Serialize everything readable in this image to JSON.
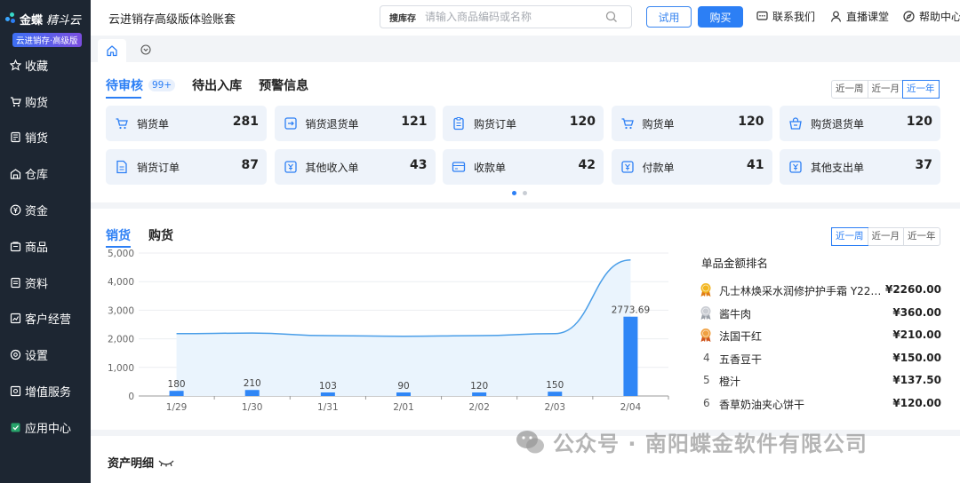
{
  "brand": {
    "name": "金蝶",
    "product": "精斗云",
    "edition_badge": "云进销存·高级版"
  },
  "sidebar": {
    "items": [
      {
        "label": "收藏",
        "icon": "star-icon"
      },
      {
        "label": "购货",
        "icon": "cart-icon"
      },
      {
        "label": "销货",
        "icon": "sales-doc-icon"
      },
      {
        "label": "仓库",
        "icon": "warehouse-icon"
      },
      {
        "label": "资金",
        "icon": "yen-icon"
      },
      {
        "label": "商品",
        "icon": "goods-icon"
      },
      {
        "label": "资料",
        "icon": "file-icon"
      },
      {
        "label": "客户经营",
        "icon": "chart-icon"
      },
      {
        "label": "设置",
        "icon": "settings-icon"
      },
      {
        "label": "增值服务",
        "icon": "value-service-icon"
      },
      {
        "label": "应用中心",
        "icon": "app-center-icon"
      }
    ]
  },
  "header": {
    "title": "云进销存高级版体验账套",
    "search_scope": "搜库存",
    "search_placeholder": "请输入商品编码或名称",
    "trial_label": "试用",
    "buy_label": "购买",
    "contact_label": "联系我们",
    "live_label": "直播课堂",
    "help_label": "帮助中心"
  },
  "pending_card": {
    "tabs": [
      {
        "label": "待审核",
        "badge": "99+"
      },
      {
        "label": "待出入库"
      },
      {
        "label": "预警信息"
      }
    ],
    "periods": [
      "近一周",
      "近一月",
      "近一年"
    ],
    "active_period": "近一年",
    "tiles": [
      {
        "label": "销货单",
        "value": "281",
        "icon": "cart-icon"
      },
      {
        "label": "销货退货单",
        "value": "121",
        "icon": "return-icon"
      },
      {
        "label": "购货订单",
        "value": "120",
        "icon": "clipboard-icon"
      },
      {
        "label": "购货单",
        "value": "120",
        "icon": "cart-icon"
      },
      {
        "label": "购货退货单",
        "value": "120",
        "icon": "basket-return-icon"
      },
      {
        "label": "销货订单",
        "value": "87",
        "icon": "doc-icon"
      },
      {
        "label": "其他收入单",
        "value": "43",
        "icon": "income-icon"
      },
      {
        "label": "收款单",
        "value": "42",
        "icon": "receipt-icon"
      },
      {
        "label": "付款单",
        "value": "41",
        "icon": "payment-icon"
      },
      {
        "label": "其他支出单",
        "value": "37",
        "icon": "expense-icon"
      }
    ]
  },
  "sales_card": {
    "tabs": [
      "销货",
      "购货"
    ],
    "periods": [
      "近一周",
      "近一月",
      "近一年"
    ],
    "active_period": "近一周",
    "ranking_title": "单品金额排名",
    "ranking": [
      {
        "rank": "1",
        "name": "凡士林焕采水润修护护手霜 Y22 ...",
        "amount": "¥2260.00",
        "medal": "gold"
      },
      {
        "rank": "2",
        "name": "酱牛肉",
        "amount": "¥360.00",
        "medal": "silver"
      },
      {
        "rank": "3",
        "name": "法国干红",
        "amount": "¥210.00",
        "medal": "bronze"
      },
      {
        "rank": "4",
        "name": "五香豆干",
        "amount": "¥150.00",
        "medal": ""
      },
      {
        "rank": "5",
        "name": "橙汁",
        "amount": "¥137.50",
        "medal": ""
      },
      {
        "rank": "6",
        "name": "香草奶油夹心饼干",
        "amount": "¥120.00",
        "medal": ""
      }
    ]
  },
  "asset_card": {
    "title": "资产明细"
  },
  "watermark": "公众号 · 南阳蝶金软件有限公司",
  "chart_data": {
    "type": "bar",
    "categories": [
      "1/29",
      "1/30",
      "1/31",
      "2/01",
      "2/02",
      "2/03",
      "2/04"
    ],
    "values": [
      180,
      210,
      103,
      90,
      120,
      150,
      2773.69
    ],
    "data_labels": [
      "180",
      "210",
      "103",
      "90",
      "120",
      "150",
      "2773.69"
    ],
    "line_values": [
      2180,
      2200,
      2110,
      2090,
      2110,
      2180,
      4760
    ],
    "ylim": [
      0,
      5000
    ],
    "yticks": [
      0,
      1000,
      2000,
      3000,
      4000,
      5000
    ],
    "ytick_labels": [
      "0",
      "1,000",
      "2,000",
      "3,000",
      "4,000",
      "5,000"
    ],
    "colors": {
      "bar": "#2f86f6",
      "line": "#4a9ee8",
      "area": "#eaf4fd"
    },
    "grid": true
  }
}
